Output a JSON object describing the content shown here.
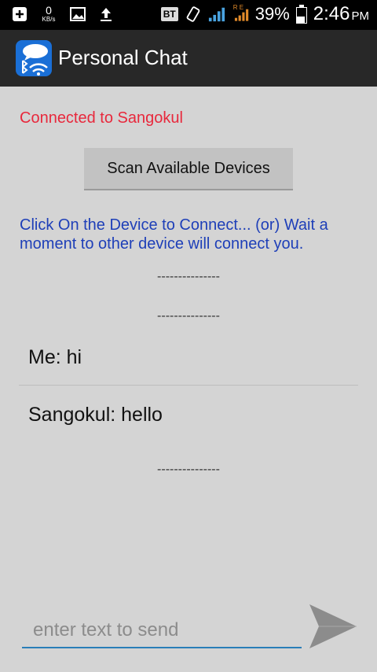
{
  "statusbar": {
    "speed_value": "0",
    "speed_unit": "KB/s",
    "bt_badge": "BT",
    "network_tag": "R E",
    "battery_pct": "39%",
    "time": "2:46",
    "ampm": "PM"
  },
  "actionbar": {
    "title": "Personal Chat"
  },
  "main": {
    "connection_status": "Connected to Sangokul",
    "scan_button": "Scan Available Devices",
    "hint": "Click On the Device to Connect... (or) Wait a moment to other device will connect you.",
    "separator": "---------------",
    "messages": [
      {
        "text": "Me:  hi"
      },
      {
        "text": "Sangokul:  hello"
      }
    ]
  },
  "composer": {
    "placeholder": "enter text to send",
    "value": ""
  },
  "colors": {
    "status_red": "#e8283c",
    "hint_blue": "#1e3fb8",
    "input_underline": "#2a7fb8"
  }
}
